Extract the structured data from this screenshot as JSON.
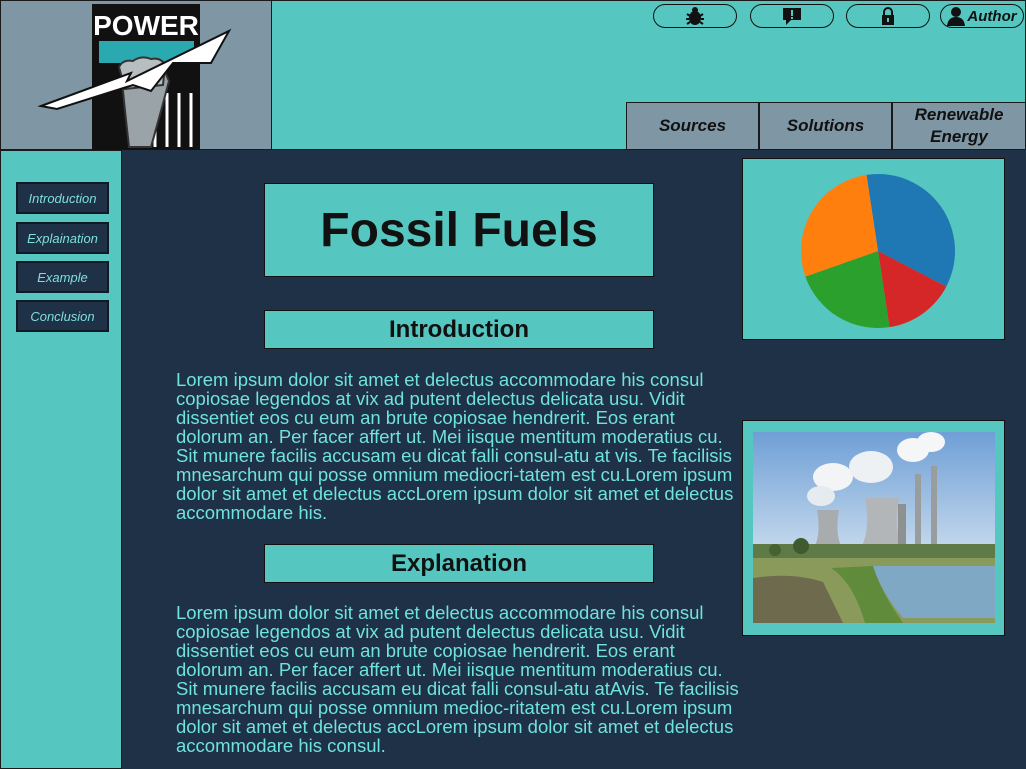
{
  "logo": {
    "text": "POWER"
  },
  "toolbar": {
    "bug_icon": "bug-icon",
    "report_icon": "alert-message-icon",
    "lock_icon": "lock-icon",
    "author_icon": "user-icon",
    "author_label": "Author"
  },
  "nav": {
    "tabs": [
      {
        "label": "Sources"
      },
      {
        "label": "Solutions"
      },
      {
        "label": "Renewable Energy"
      }
    ]
  },
  "sidebar": {
    "items": [
      {
        "label": "Introduction"
      },
      {
        "label": "Explaination"
      },
      {
        "label": "Example"
      },
      {
        "label": "Conclusion"
      }
    ]
  },
  "main": {
    "title": "Fossil Fuels",
    "sections": [
      {
        "heading": "Introduction",
        "body": "Lorem ipsum dolor sit amet et delectus accommodare his consul copiosae legendos at vix ad putent delectus delicata usu. Vidit dissentiet eos cu eum an brute copiosae hendrerit. Eos erant dolorum an. Per facer affert ut. Mei iisque mentitum moderatius cu. Sit munere facilis accusam eu dicat falli consul-atu at vis. Te facilisis mnesarchum qui posse omnium mediocri-tatem est cu.Lorem ipsum dolor sit amet et delectus accLorem ipsum dolor sit amet et delectus accommodare his."
      },
      {
        "heading": "Explanation",
        "body": "Lorem ipsum dolor sit amet et delectus accommodare his consul copiosae legendos at vix ad putent delectus delicata usu. Vidit dissentiet eos cu eum an brute copiosae hendrerit. Eos erant dolorum an. Per facer affert ut. Mei iisque mentitum moderatius cu. Sit munere facilis accusam eu dicat falli consul-atu atAvis. Te facilisis mnesarchum qui posse omnium medioc-ritatem est cu.Lorem ipsum dolor sit amet et delectus accLorem ipsum dolor sit amet et delectus accommodare his consul."
      }
    ]
  },
  "chart_data": {
    "type": "pie",
    "values": [
      35,
      15,
      22,
      28
    ],
    "colors": [
      "#1f77b4",
      "#d62728",
      "#2ca02c",
      "#ff7f0e"
    ]
  },
  "colors": {
    "teal": "#55c6c0",
    "navy": "#1f3146",
    "slate": "#7f97a4",
    "text_teal": "#6fe3de"
  }
}
